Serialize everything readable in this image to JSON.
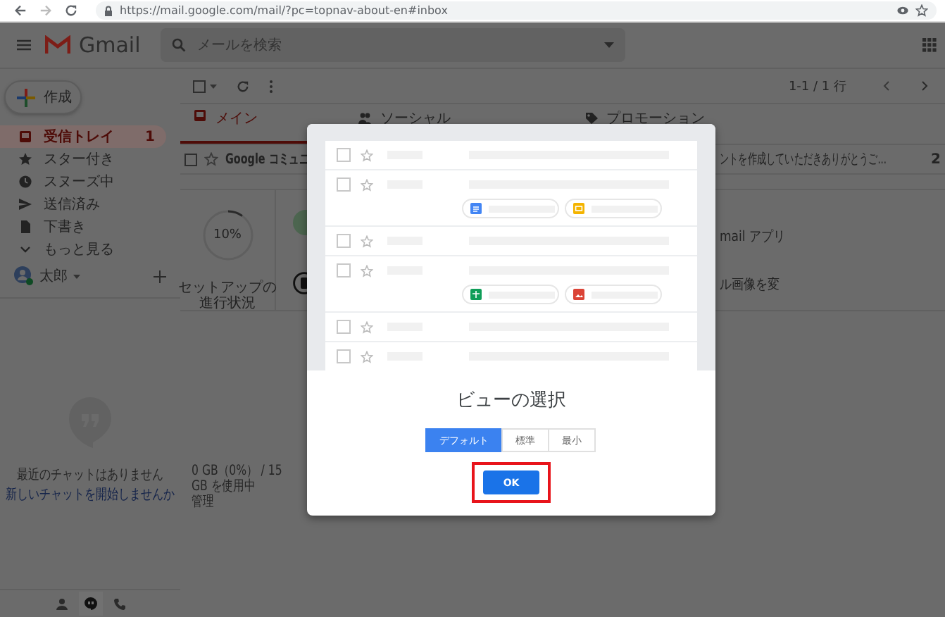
{
  "browser": {
    "url": "https://mail.google.com/mail/?pc=topnav-about-en#inbox"
  },
  "header": {
    "app_name": "Gmail",
    "search": {
      "placeholder": "メールを検索"
    }
  },
  "sidebar": {
    "compose": "作成",
    "items": [
      {
        "label": "受信トレイ",
        "kind": "inbox",
        "selected": true,
        "count": "1"
      },
      {
        "label": "スター付き",
        "kind": "starred",
        "selected": false
      },
      {
        "label": "スヌーズ中",
        "kind": "snoozed",
        "selected": false
      },
      {
        "label": "送信済み",
        "kind": "sent",
        "selected": false
      },
      {
        "label": "下書き",
        "kind": "drafts",
        "selected": false
      },
      {
        "label": "もっと見る",
        "kind": "more",
        "selected": false
      }
    ],
    "account": "太郎",
    "chat": {
      "message": "最近のチャットはありません",
      "link": "新しいチャットを開始しませんか"
    }
  },
  "toolbar": {
    "select_all_checked": false,
    "range": "1-1 / 1 行"
  },
  "tabs": [
    {
      "label": "メイン",
      "kind": "primary",
      "selected": true
    },
    {
      "label": "ソーシャル",
      "kind": "social",
      "selected": false
    },
    {
      "label": "プロモーション",
      "kind": "promotions",
      "selected": false
    }
  ],
  "emails": [
    {
      "checked": false,
      "sender": "Google コミュニ",
      "snippet": "ントを作成していただきありがとうご...",
      "date": "2"
    }
  ],
  "setup": {
    "progress": {
      "reading": "10%",
      "level": 0.1
    },
    "caption": "セットアップの進行状況"
  },
  "cards": [
    "mail アプリ",
    "ル画像を変"
  ],
  "storage": {
    "usage": "0 GB（0%） / 15 GB を使用中",
    "manage": "管理"
  },
  "dialog": {
    "preview_rows": [
      {
        "kind": "plain",
        "checked": false
      },
      {
        "kind": "attachments",
        "checked": false,
        "chips": [
          {
            "kind": "doc",
            "color": "#4285f4"
          },
          {
            "kind": "slides",
            "color": "#f4b400"
          }
        ]
      },
      {
        "kind": "plain",
        "checked": false
      },
      {
        "kind": "attachments",
        "checked": false,
        "chips": [
          {
            "kind": "sheet",
            "color": "#0f9d58"
          },
          {
            "kind": "image",
            "color": "#db4437"
          }
        ]
      },
      {
        "kind": "plain",
        "checked": false
      },
      {
        "kind": "plain",
        "checked": false
      }
    ],
    "title": "ビューの選択",
    "options": [
      {
        "label": "デフォルト",
        "selected": true
      },
      {
        "label": "標準",
        "selected": false
      },
      {
        "label": "最小",
        "selected": false
      }
    ],
    "ok": "OK",
    "ok_highlighted": true
  }
}
